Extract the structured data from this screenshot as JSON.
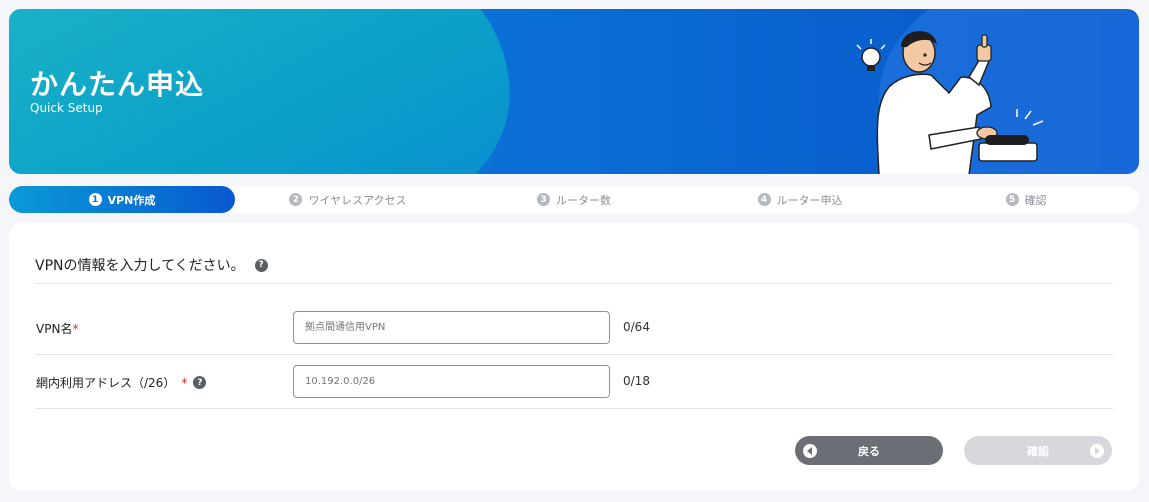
{
  "banner": {
    "title": "かんたん申込",
    "subtitle": "Quick Setup"
  },
  "steps": [
    {
      "num": "1",
      "label": "VPN作成",
      "active": true
    },
    {
      "num": "2",
      "label": "ワイヤレスアクセス",
      "active": false
    },
    {
      "num": "3",
      "label": "ルーター数",
      "active": false
    },
    {
      "num": "4",
      "label": "ルーター申込",
      "active": false
    },
    {
      "num": "5",
      "label": "確認",
      "active": false
    }
  ],
  "form": {
    "heading": "VPNの情報を入力してください。",
    "help_glyph": "?",
    "required_mark": "*",
    "vpn_name": {
      "label": "VPN名",
      "placeholder": "拠点間通信用VPN",
      "value": "",
      "counter": "0/64"
    },
    "address": {
      "label": "網内利用アドレス（/26）",
      "placeholder": "10.192.0.0/26",
      "value": "",
      "counter": "0/18"
    }
  },
  "buttons": {
    "back_label": "戻る",
    "confirm_label": "確認"
  },
  "colors": {
    "accent": "#0a6fd6",
    "required": "#e02020",
    "back_button": "#6b6f75",
    "disabled_button": "#d6d8db"
  }
}
